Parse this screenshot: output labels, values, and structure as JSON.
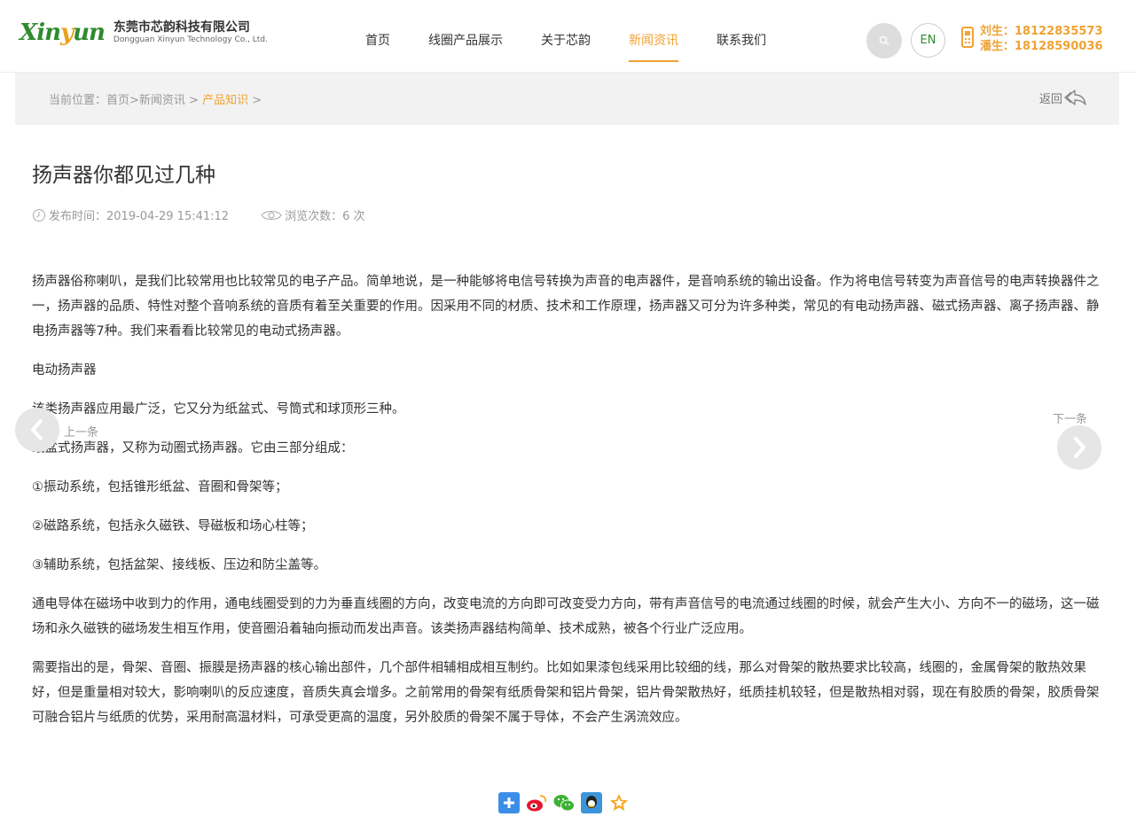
{
  "header": {
    "logo_mark": "Xinyun",
    "logo_cn": "东莞市芯韵科技有限公司",
    "logo_en": "Dongguan Xinyun Technology Co., Ltd.",
    "nav": [
      {
        "label": "首页",
        "active": false
      },
      {
        "label": "线圈产品展示",
        "active": false
      },
      {
        "label": "关于芯韵",
        "active": false
      },
      {
        "label": "新闻资讯",
        "active": true
      },
      {
        "label": "联系我们",
        "active": false
      }
    ],
    "lang_label": "EN",
    "phones": [
      "刘生：18122835573",
      "潘生：18128590036"
    ]
  },
  "breadcrumb": {
    "prefix": "当前位置：首页>新闻资讯 >",
    "current": "产品知识",
    "suffix": ">",
    "back_label": "返回"
  },
  "article": {
    "title": "扬声器你都见过几种",
    "publish_time": "发布时间：2019-04-29 15:41:12",
    "views": "浏览次数：6 次",
    "paragraphs": [
      "扬声器俗称喇叭，是我们比较常用也比较常见的电子产品。简单地说，是一种能够将电信号转换为声音的电声器件，是音响系统的输出设备。作为将电信号转变为声音信号的电声转换器件之一，扬声器的品质、特性对整个音响系统的音质有着至关重要的作用。因采用不同的材质、技术和工作原理，扬声器又可分为许多种类，常见的有电动扬声器、磁式扬声器、离子扬声器、静电扬声器等7种。我们来看看比较常见的电动式扬声器。",
      "电动扬声器",
      "该类扬声器应用最广泛，它又分为纸盆式、号筒式和球顶形三种。",
      "纸盆式扬声器，又称为动圈式扬声器。它由三部分组成：",
      "①振动系统，包括锥形纸盆、音圈和骨架等；",
      "②磁路系统，包括永久磁铁、导磁板和场心柱等；",
      "③辅助系统，包括盆架、接线板、压边和防尘盖等。",
      "通电导体在磁场中收到力的作用，通电线圈受到的力为垂直线圈的方向，改变电流的方向即可改变受力方向，带有声音信号的电流通过线圈的时候，就会产生大小、方向不一的磁场，这一磁场和永久磁铁的磁场发生相互作用，使音圈沿着轴向振动而发出声音。该类扬声器结构简单、技术成熟，被各个行业广泛应用。",
      "需要指出的是，骨架、音圈、振膜是扬声器的核心输出部件，几个部件相辅相成相互制约。比如如果漆包线采用比较细的线，那么对骨架的散热要求比较高，线圈的，金属骨架的散热效果好，但是重量相对较大，影响喇叭的反应速度，音质失真会增多。之前常用的骨架有纸质骨架和铝片骨架，铝片骨架散热好，纸质挂机较轻，但是散热相对弱，现在有胶质的骨架，胶质骨架可融合铝片与纸质的优势，采用耐高温材料，可承受更高的温度，另外胶质的骨架不属于导体，不会产生涡流效应。"
    ]
  },
  "pager": {
    "prev_label": "上一条",
    "next_label": "下一条"
  },
  "share": [
    "plus-share-icon",
    "weibo-icon",
    "wechat-icon",
    "qq-icon",
    "favorite-star-icon"
  ],
  "colors": {
    "accent": "#f0a232",
    "brand_green": "#2e8b2e"
  }
}
